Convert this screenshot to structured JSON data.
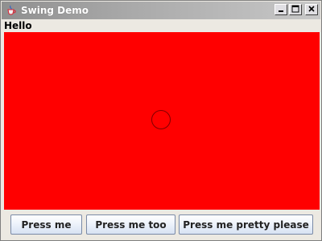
{
  "window": {
    "title": "Swing Demo",
    "icons": {
      "app": "java-cup-icon",
      "minimize": "minimize-icon",
      "maximize": "maximize-icon",
      "close": "close-icon"
    }
  },
  "label": {
    "text": "Hello"
  },
  "canvas": {
    "background_color": "#ff0000",
    "shape": "circle-outline"
  },
  "buttons": {
    "b1": "Press me",
    "b2": "Press me too",
    "b3": "Press me pretty please"
  }
}
